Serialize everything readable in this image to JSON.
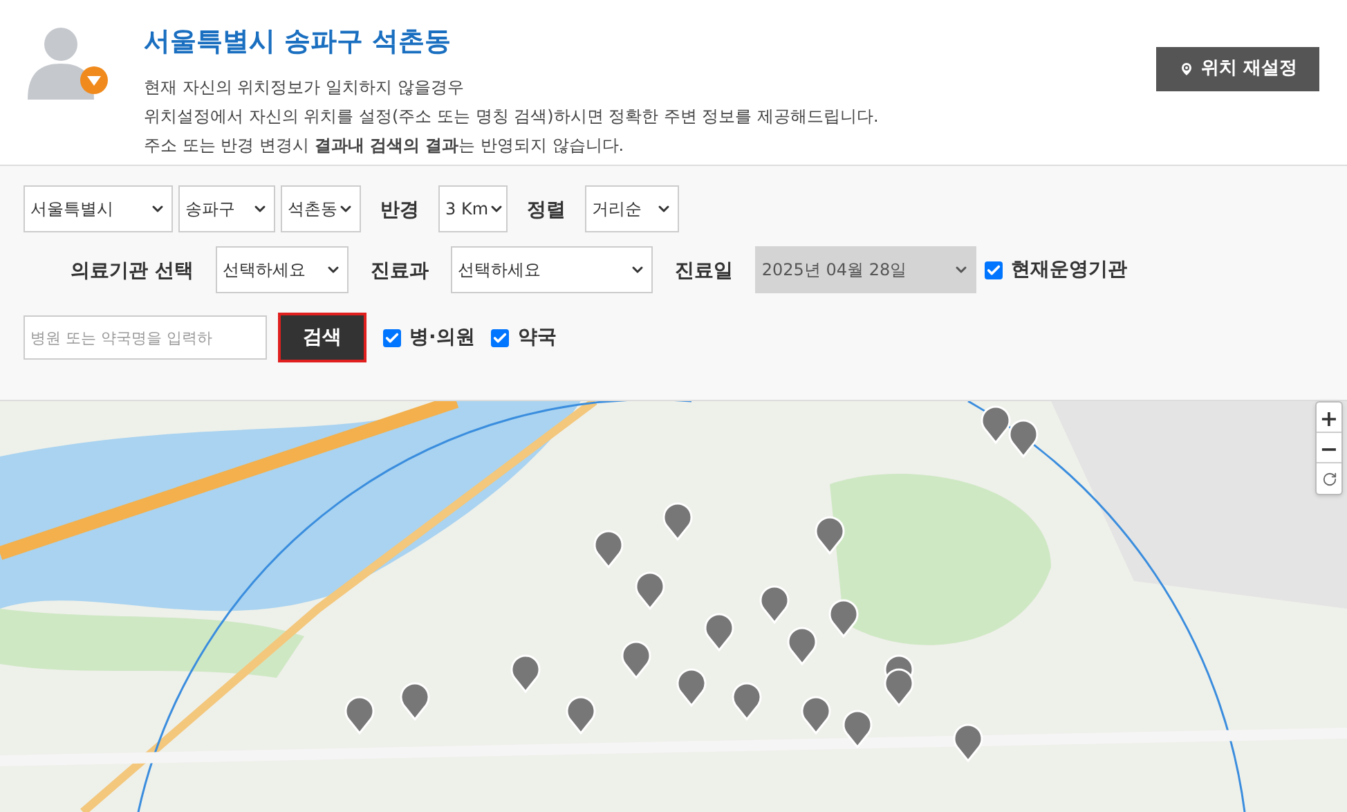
{
  "header": {
    "title": "서울특별시 송파구 석촌동",
    "lines": [
      "현재 자신의 위치정보가 일치하지 않을경우",
      "위치설정에서 자신의 위치를 설정(주소 또는 명칭 검색)하시면 정확한 주변 정보를 제공해드립니다.",
      "주소 또는 반경 변경시 **결과내 검색의 결과**는 반영되지 않습니다."
    ],
    "reset_button": "위치 재설정"
  },
  "filters": {
    "row1": [
      {
        "kind": "select",
        "value": "서울특별시"
      },
      {
        "kind": "select",
        "value": "송파구"
      },
      {
        "kind": "select",
        "value": "석촌동"
      },
      {
        "kind": "label",
        "text": "반경"
      },
      {
        "kind": "select",
        "value": "3 Km"
      },
      {
        "kind": "label",
        "text": "정렬"
      },
      {
        "kind": "select",
        "value": "거리순"
      }
    ],
    "row2": [
      {
        "kind": "label",
        "text": "의료기관 선택"
      },
      {
        "kind": "select",
        "value": "선택하세요"
      },
      {
        "kind": "label",
        "text": "진료과"
      },
      {
        "kind": "select",
        "value": "선택하세요"
      },
      {
        "kind": "label",
        "text": "진료일"
      },
      {
        "kind": "select",
        "value": "2025년 04월 28일",
        "disabled": true
      },
      {
        "kind": "checkbox",
        "text": "현재운영기관",
        "checked": true
      }
    ],
    "row3": [
      {
        "kind": "input",
        "placeholder": "병원 또는 약국명을 입력하"
      },
      {
        "kind": "button",
        "text": "검색"
      },
      {
        "kind": "checkbox",
        "text": "병·의원",
        "checked": true
      },
      {
        "kind": "checkbox",
        "text": "약국",
        "checked": true
      }
    ]
  },
  "map": {
    "zoom_in": "+",
    "zoom_out": "−"
  }
}
